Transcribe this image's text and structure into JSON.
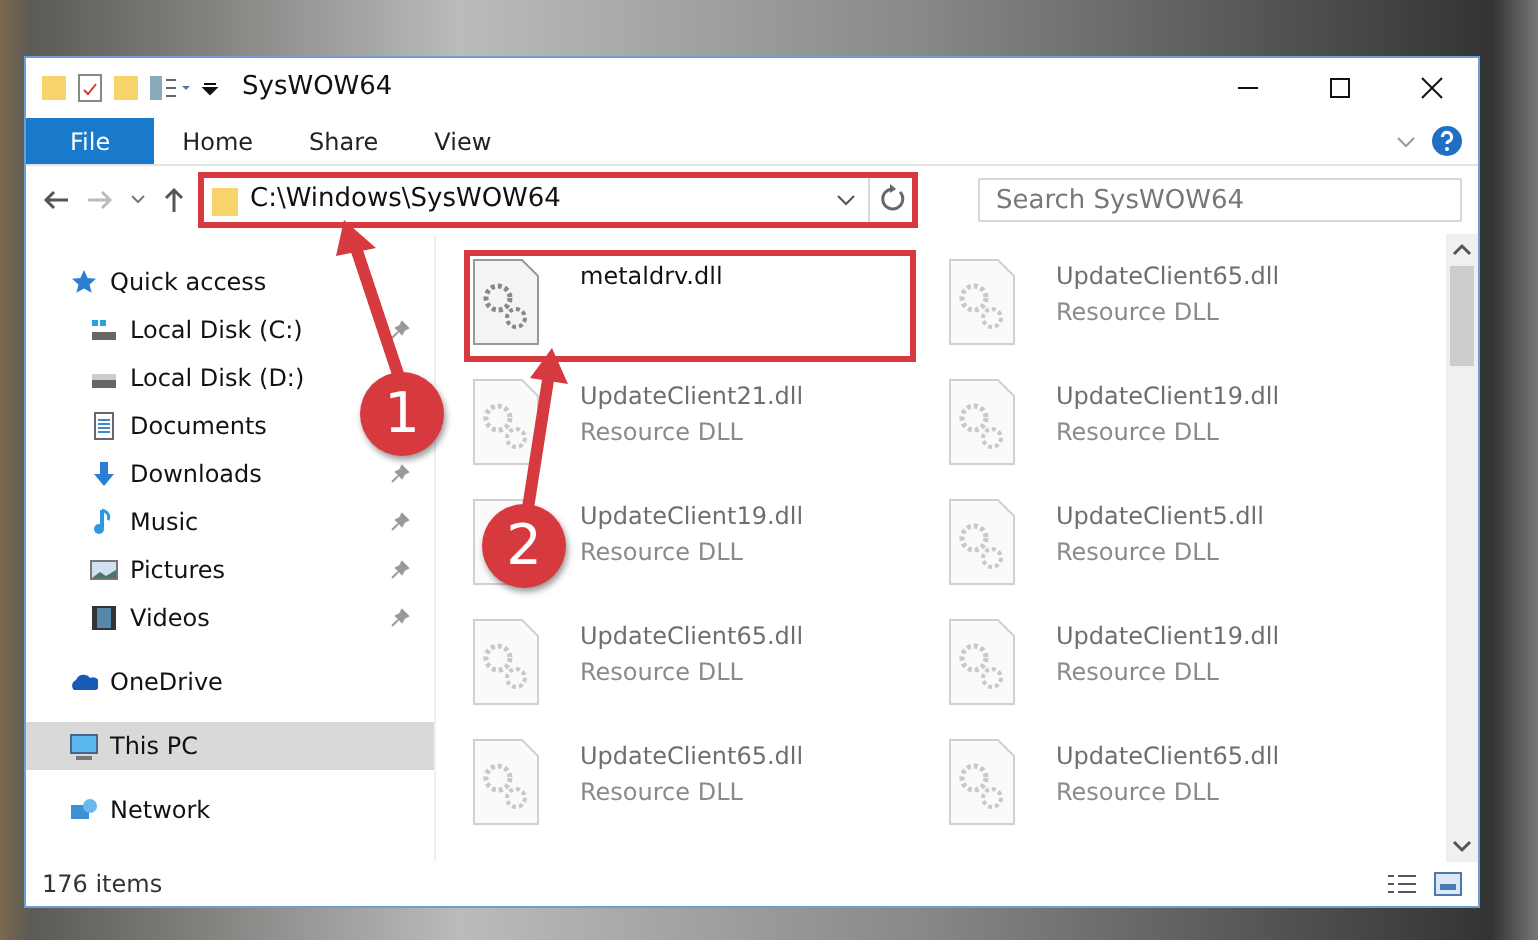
{
  "window": {
    "title": "SysWOW64"
  },
  "ribbon_tabs": [
    {
      "label": "File",
      "selected": true
    },
    {
      "label": "Home",
      "selected": false
    },
    {
      "label": "Share",
      "selected": false
    },
    {
      "label": "View",
      "selected": false
    }
  ],
  "address_bar": {
    "path": "C:\\Windows\\SysWOW64",
    "highlighted": true
  },
  "search": {
    "placeholder": "Search SysWOW64"
  },
  "sidebar": {
    "items": [
      {
        "label": "Quick access",
        "selected": false,
        "children": [
          {
            "label": "Local Disk (C:)",
            "pinned": true,
            "selected": false
          },
          {
            "label": "Local Disk (D:)",
            "pinned": false,
            "selected": false
          },
          {
            "label": "Documents",
            "pinned": false,
            "selected": false
          },
          {
            "label": "Downloads",
            "pinned": true,
            "selected": false
          },
          {
            "label": "Music",
            "pinned": true,
            "selected": false
          },
          {
            "label": "Pictures",
            "pinned": true,
            "selected": false
          },
          {
            "label": "Videos",
            "pinned": true,
            "selected": false
          }
        ]
      },
      {
        "label": "OneDrive",
        "selected": false
      },
      {
        "label": "This PC",
        "selected": true
      },
      {
        "label": "Network",
        "selected": false
      }
    ]
  },
  "files": [
    {
      "name": "metaldrv.dll",
      "blurred": false,
      "highlighted": true
    },
    {
      "name": "UpdateClient65.dll",
      "type": "Resource DLL",
      "blurred": true,
      "highlighted": false
    },
    {
      "name": "UpdateClient21.dll",
      "type": "Resource DLL",
      "blurred": true,
      "highlighted": false
    },
    {
      "name": "UpdateClient19.dll",
      "type": "Resource DLL",
      "blurred": true,
      "highlighted": false
    },
    {
      "name": "UpdateClient19.dll",
      "type": "Resource DLL",
      "blurred": true,
      "highlighted": false
    },
    {
      "name": "UpdateClient5.dll",
      "type": "Resource DLL",
      "blurred": true,
      "highlighted": false
    },
    {
      "name": "UpdateClient65.dll",
      "type": "Resource DLL",
      "blurred": true,
      "highlighted": false
    },
    {
      "name": "UpdateClient19.dll",
      "type": "Resource DLL",
      "blurred": true,
      "highlighted": false
    },
    {
      "name": "UpdateClient65.dll",
      "type": "Resource DLL",
      "blurred": true,
      "highlighted": false
    },
    {
      "name": "UpdateClient65.dll",
      "type": "Resource DLL",
      "blurred": true,
      "highlighted": false
    }
  ],
  "callouts": [
    {
      "number": "1"
    },
    {
      "number": "2"
    }
  ],
  "status_bar": {
    "count": "176 items"
  }
}
